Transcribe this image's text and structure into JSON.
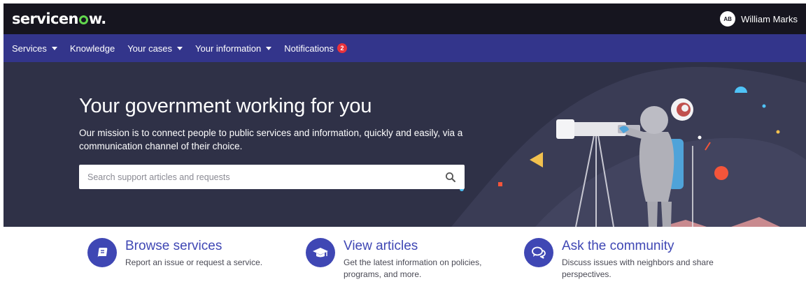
{
  "header": {
    "logo_text_a": "servicen",
    "logo_text_b": "w",
    "logo_text_c": ".",
    "user_initials": "AB",
    "user_name": "William Marks"
  },
  "nav": {
    "items": [
      {
        "label": "Services",
        "dropdown": true
      },
      {
        "label": "Knowledge",
        "dropdown": false
      },
      {
        "label": "Your cases",
        "dropdown": true
      },
      {
        "label": "Your information",
        "dropdown": true
      },
      {
        "label": "Notifications",
        "dropdown": false
      }
    ],
    "notification_count": "2"
  },
  "hero": {
    "title": "Your government working for you",
    "subtitle": "Our mission is to connect people to public services and information, quickly and easily, via a communication channel of their choice.",
    "search_placeholder": "Search support articles and requests"
  },
  "features": [
    {
      "icon": "book-icon",
      "title": "Browse services",
      "description": "Report an issue or request a service."
    },
    {
      "icon": "graduation-cap-icon",
      "title": "View articles",
      "description": "Get the latest information on policies, programs, and more."
    },
    {
      "icon": "chat-bubbles-icon",
      "title": "Ask the community",
      "description": "Discuss issues with neighbors and share perspectives."
    }
  ],
  "colors": {
    "topbar": "#16151f",
    "navbar": "#33358b",
    "hero": "#2f3147",
    "accent": "#3f47b4",
    "badge": "#e8323c",
    "logo_green": "#62d84e"
  }
}
